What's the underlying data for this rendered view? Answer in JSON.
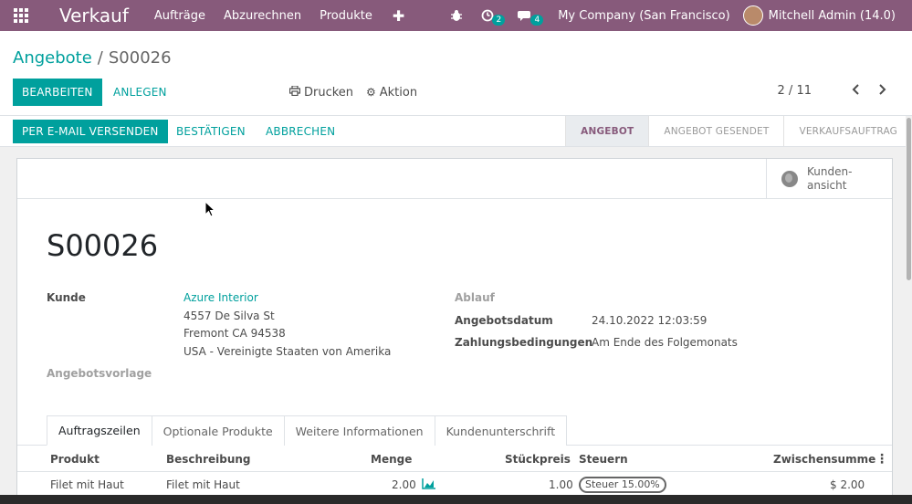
{
  "nav": {
    "brand": "Verkauf",
    "menu": [
      "Aufträge",
      "Abzurechnen",
      "Produkte"
    ],
    "activity_count": "2",
    "messages_count": "4",
    "company": "My Company (San Francisco)",
    "user": "Mitchell Admin (14.0)",
    "icons": [
      "apps-icon",
      "plus-icon",
      "bug-icon",
      "clock-icon",
      "chat-icon"
    ]
  },
  "control": {
    "breadcrumb_parent": "Angebote",
    "breadcrumb_sep": "/",
    "breadcrumb_current": "S00026",
    "edit_label": "BEARBEITEN",
    "create_label": "ANLEGEN",
    "print_label": "Drucken",
    "action_label": "Aktion",
    "pager": "2 / 11"
  },
  "statusbar": {
    "email_label": "PER E-MAIL VERSENDEN",
    "confirm_label": "BESTÄTIGEN",
    "cancel_label": "ABBRECHEN",
    "stages": [
      "ANGEBOT",
      "ANGEBOT GESENDET",
      "VERKAUFSAUFTRAG"
    ],
    "active_stage": "ANGEBOT"
  },
  "sheet": {
    "smart_button": "Kunden-\nansicht",
    "smart_button_line1": "Kunden-",
    "smart_button_line2": "ansicht",
    "title": "S00026",
    "customer_label": "Kunde",
    "customer_name": "Azure Interior",
    "address_line1": "4557 De Silva St",
    "address_line2": "Fremont CA 94538",
    "address_line3": "USA - Vereinigte Staaten von Amerika",
    "template_label": "Angebotsvorlage",
    "expiry_label": "Ablauf",
    "date_label": "Angebotsdatum",
    "date_value": "24.10.2022 12:03:59",
    "terms_label": "Zahlungsbedingungen",
    "terms_value": "Am Ende des Folgemonats"
  },
  "tabs": [
    "Auftragszeilen",
    "Optionale Produkte",
    "Weitere Informationen",
    "Kundenunterschrift"
  ],
  "table": {
    "headers": {
      "product": "Produkt",
      "description": "Beschreibung",
      "quantity": "Menge",
      "price": "Stückpreis",
      "taxes": "Steuern",
      "subtotal": "Zwischensumme"
    },
    "rows": [
      {
        "product": "Filet mit Haut",
        "description": "Filet mit Haut",
        "quantity": "2.00",
        "price": "1.00",
        "taxes": "Steuer 15.00%",
        "subtotal": "$ 2.00"
      }
    ]
  },
  "colors": {
    "brand": "#875a7b",
    "accent": "#00a09d"
  }
}
